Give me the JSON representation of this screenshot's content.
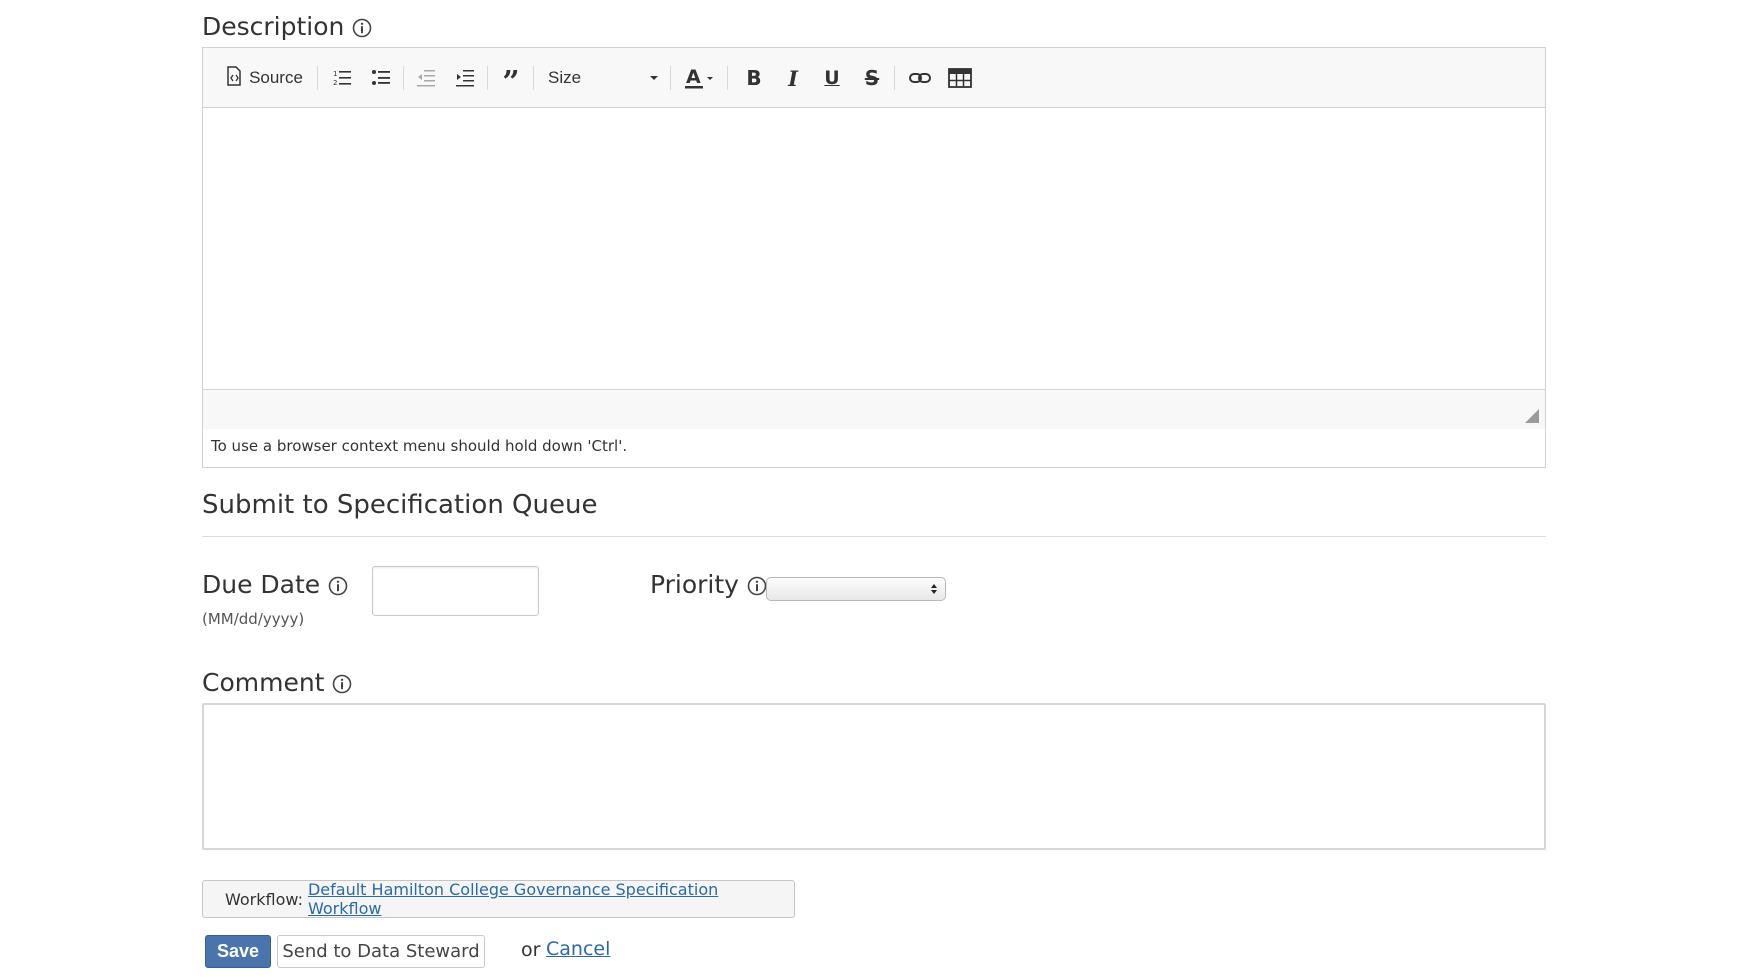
{
  "description": {
    "label": "Description",
    "toolbar": {
      "source_label": "Source",
      "size_label": "Size",
      "icons": [
        "source-icon",
        "numbered-list-icon",
        "bulleted-list-icon",
        "outdent-icon",
        "indent-icon",
        "blockquote-icon",
        "font-size-dropdown",
        "text-color-icon",
        "bold-icon",
        "italic-icon",
        "underline-icon",
        "strikethrough-icon",
        "link-icon",
        "table-icon"
      ]
    },
    "hint": "To use a browser context menu should hold down 'Ctrl'."
  },
  "submit_section": {
    "title": "Submit to Specification Queue",
    "due_date": {
      "label": "Due Date",
      "format_hint": "(MM/dd/yyyy)",
      "value": ""
    },
    "priority": {
      "label": "Priority",
      "selected": ""
    },
    "comment": {
      "label": "Comment",
      "value": ""
    }
  },
  "workflow": {
    "label": "Workflow:",
    "link_text": "Default Hamilton College Governance Specification Workflow"
  },
  "actions": {
    "save_label": "Save",
    "send_label": "Send to Data Steward",
    "or_text": "or",
    "cancel_label": "Cancel"
  },
  "colors": {
    "primary_button": "#4a74ac",
    "link": "#2a6aa8"
  }
}
